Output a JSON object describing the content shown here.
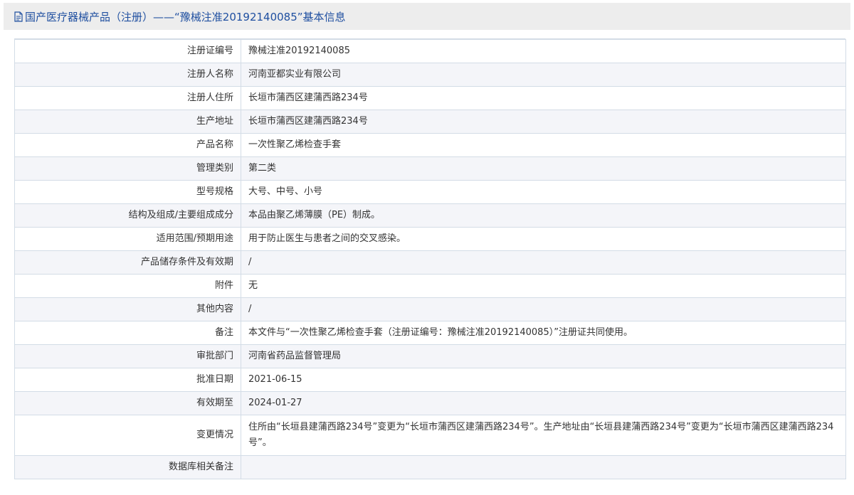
{
  "header": {
    "icon": "document-icon",
    "title": "国产医疗器械产品（注册）——“豫械注准20192140085”基本信息"
  },
  "rows": [
    {
      "label": "注册证编号",
      "value": "豫械注准20192140085"
    },
    {
      "label": "注册人名称",
      "value": "河南亚都实业有限公司"
    },
    {
      "label": "注册人住所",
      "value": "长垣市蒲西区建蒲西路234号"
    },
    {
      "label": "生产地址",
      "value": "长垣市蒲西区建蒲西路234号"
    },
    {
      "label": "产品名称",
      "value": "一次性聚乙烯检查手套"
    },
    {
      "label": "管理类别",
      "value": "第二类"
    },
    {
      "label": "型号规格",
      "value": "大号、中号、小号"
    },
    {
      "label": "结构及组成/主要组成成分",
      "value": "本品由聚乙烯薄膜（PE）制成。"
    },
    {
      "label": "适用范围/预期用途",
      "value": "用于防止医生与患者之间的交叉感染。"
    },
    {
      "label": "产品储存条件及有效期",
      "value": "/"
    },
    {
      "label": "附件",
      "value": "无"
    },
    {
      "label": "其他内容",
      "value": "/"
    },
    {
      "label": "备注",
      "value": "本文件与“一次性聚乙烯检查手套（注册证编号：豫械注准20192140085）”注册证共同使用。"
    },
    {
      "label": "审批部门",
      "value": "河南省药品监督管理局"
    },
    {
      "label": "批准日期",
      "value": "2021-06-15"
    },
    {
      "label": "有效期至",
      "value": "2024-01-27"
    },
    {
      "label": "变更情况",
      "value": "住所由“长垣县建蒲西路234号”变更为“长垣市蒲西区建蒲西路234号”。生产地址由“长垣县建蒲西路234号”变更为“长垣市蒲西区建蒲西路234号”。"
    },
    {
      "label": "数据库相关备注",
      "value": ""
    }
  ]
}
